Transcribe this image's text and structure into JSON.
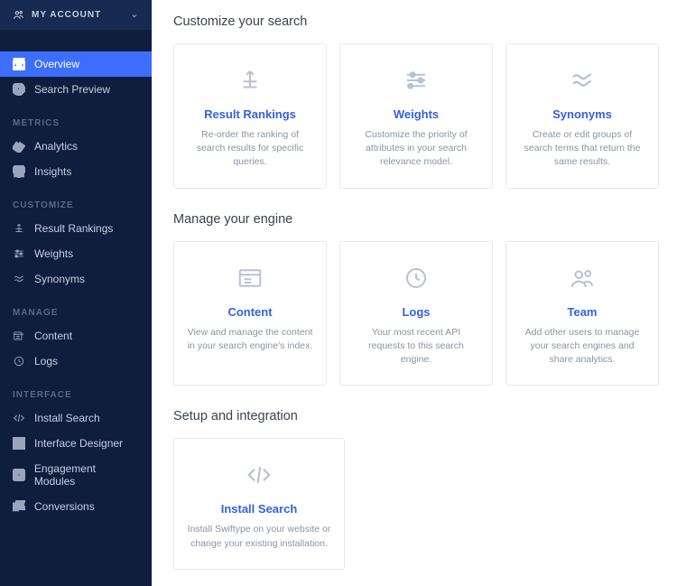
{
  "account": {
    "label": "MY ACCOUNT"
  },
  "sidebar": {
    "top": [
      {
        "label": "Overview",
        "name": "sidebar-item-overview",
        "icon": "binoculars-icon",
        "active": true
      },
      {
        "label": "Search Preview",
        "name": "sidebar-item-search-preview",
        "icon": "search-icon",
        "active": false
      }
    ],
    "sections": [
      {
        "label": "METRICS",
        "items": [
          {
            "label": "Analytics",
            "name": "sidebar-item-analytics",
            "icon": "analytics-icon"
          },
          {
            "label": "Insights",
            "name": "sidebar-item-insights",
            "icon": "bulb-icon"
          }
        ]
      },
      {
        "label": "CUSTOMIZE",
        "items": [
          {
            "label": "Result Rankings",
            "name": "sidebar-item-result-rankings",
            "icon": "rankings-icon"
          },
          {
            "label": "Weights",
            "name": "sidebar-item-weights",
            "icon": "sliders-icon"
          },
          {
            "label": "Synonyms",
            "name": "sidebar-item-synonyms",
            "icon": "approx-icon"
          }
        ]
      },
      {
        "label": "MANAGE",
        "items": [
          {
            "label": "Content",
            "name": "sidebar-item-content",
            "icon": "content-icon"
          },
          {
            "label": "Logs",
            "name": "sidebar-item-logs",
            "icon": "clock-icon"
          }
        ]
      },
      {
        "label": "INTERFACE",
        "items": [
          {
            "label": "Install Search",
            "name": "sidebar-item-install-search",
            "icon": "code-icon"
          },
          {
            "label": "Interface Designer",
            "name": "sidebar-item-interface-designer",
            "icon": "designer-icon"
          },
          {
            "label": "Engagement Modules",
            "name": "sidebar-item-engagement-modules",
            "icon": "engagement-icon"
          },
          {
            "label": "Conversions",
            "name": "sidebar-item-conversions",
            "icon": "flag-icon"
          }
        ]
      }
    ]
  },
  "main": {
    "groups": [
      {
        "title": "Customize your search",
        "cards": [
          {
            "name": "card-result-rankings",
            "icon": "rankings-icon",
            "title": "Result Rankings",
            "desc": "Re-order the ranking of search results for specific queries."
          },
          {
            "name": "card-weights",
            "icon": "sliders-icon",
            "title": "Weights",
            "desc": "Customize the priority of attributes in your search relevance model."
          },
          {
            "name": "card-synonyms",
            "icon": "approx-icon",
            "title": "Synonyms",
            "desc": "Create or edit groups of search terms that return the same results."
          }
        ]
      },
      {
        "title": "Manage your engine",
        "cards": [
          {
            "name": "card-content",
            "icon": "content-icon",
            "title": "Content",
            "desc": "View and manage the content in your search engine's index."
          },
          {
            "name": "card-logs",
            "icon": "clock-icon",
            "title": "Logs",
            "desc": "Your most recent API requests to this search engine."
          },
          {
            "name": "card-team",
            "icon": "team-icon",
            "title": "Team",
            "desc": "Add other users to manage your search engines and share analytics."
          }
        ]
      },
      {
        "title": "Setup and integration",
        "cards": [
          {
            "name": "card-install-search",
            "icon": "code-icon",
            "title": "Install Search",
            "desc": "Install Swiftype on your website or change your existing installation."
          }
        ]
      }
    ]
  }
}
